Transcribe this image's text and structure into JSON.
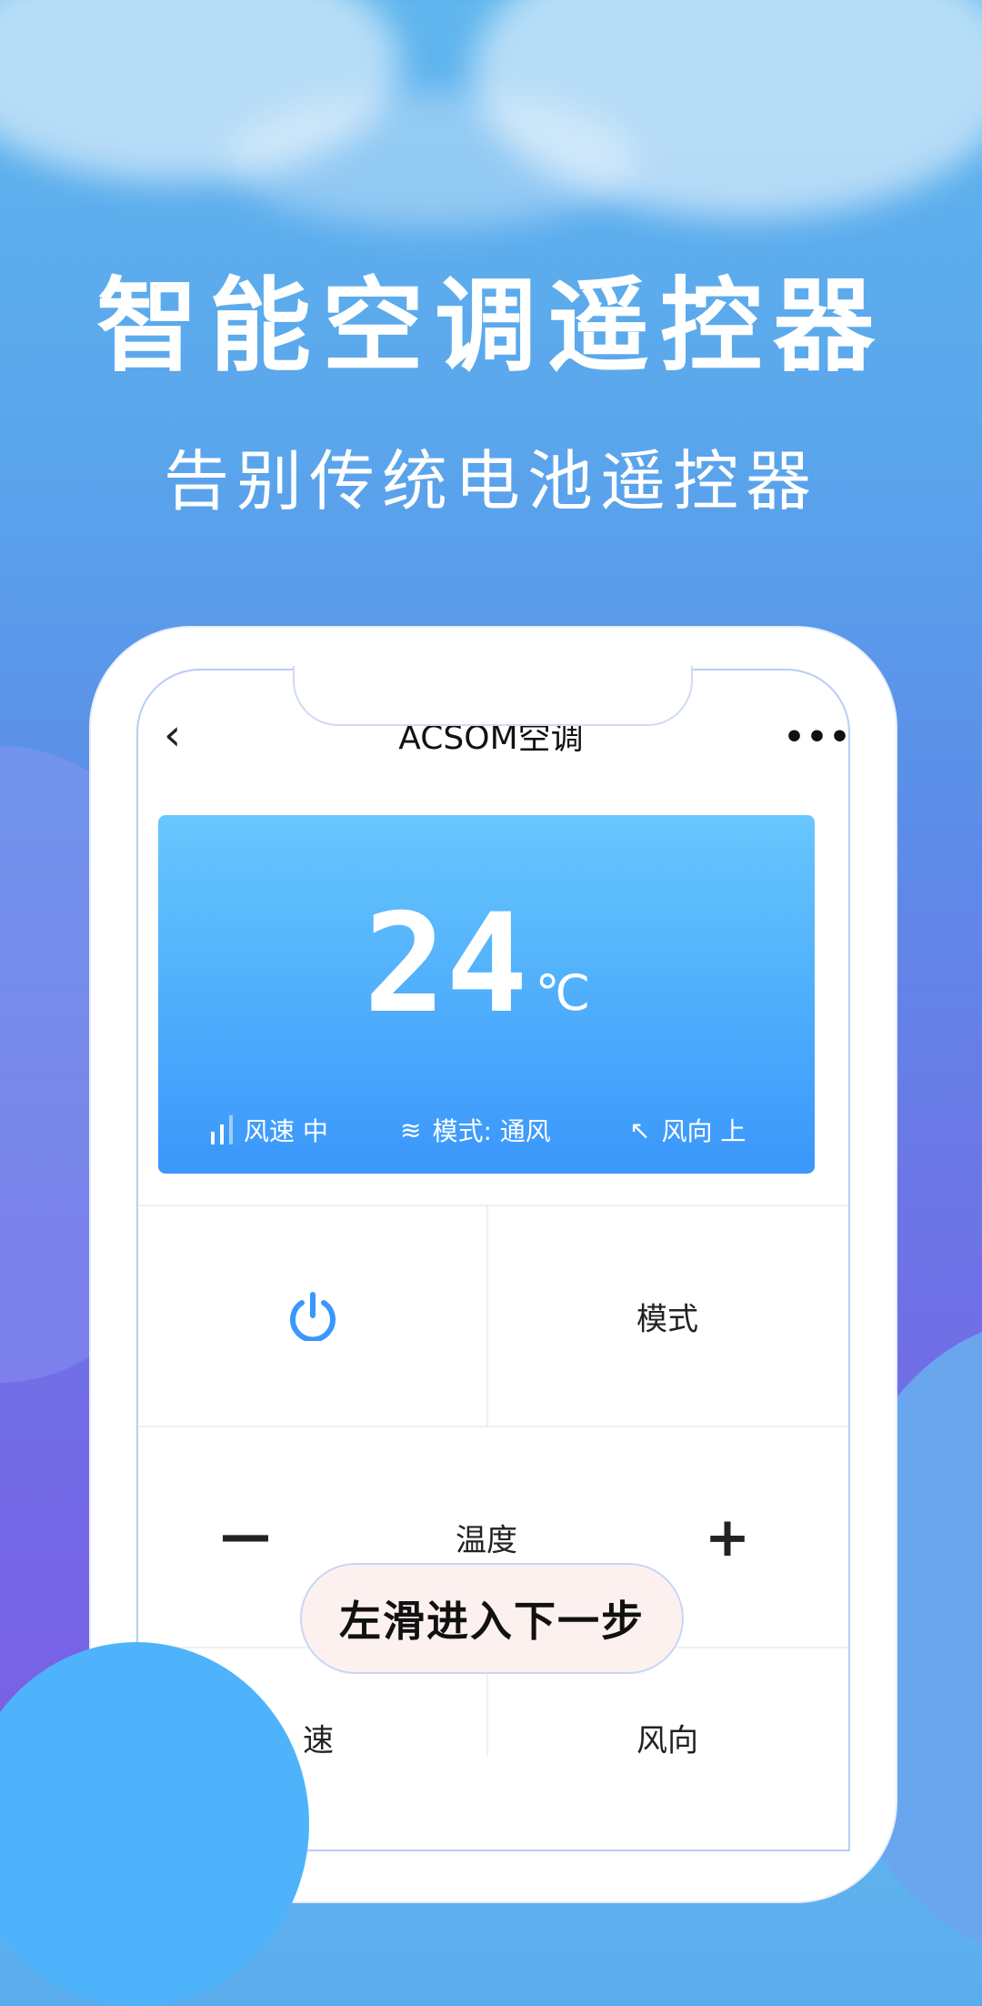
{
  "promo": {
    "headline": "智能空调遥控器",
    "subtitle": "告别传统电池遥控器",
    "swipe_hint": "左滑进入下一步"
  },
  "app": {
    "title": "ACSOM空调",
    "back_icon": "chevron-left-icon",
    "more_icon": "more-horizontal-icon"
  },
  "display": {
    "temperature": "24",
    "unit": "℃",
    "status": [
      {
        "icon": "signal-bars-icon",
        "label": "风速 中"
      },
      {
        "icon": "wind-icon",
        "label": "模式: 通风"
      },
      {
        "icon": "swing-direction-icon",
        "label": "风向 上"
      }
    ]
  },
  "controls": {
    "power_icon": "power-icon",
    "mode": "模式",
    "temp_label": "温度",
    "minus": "—",
    "plus": "+",
    "fan_speed_partial": "速",
    "direction_partial": "风向"
  },
  "colors": {
    "accent": "#3a97fb",
    "card_top": "#67c7fd"
  }
}
